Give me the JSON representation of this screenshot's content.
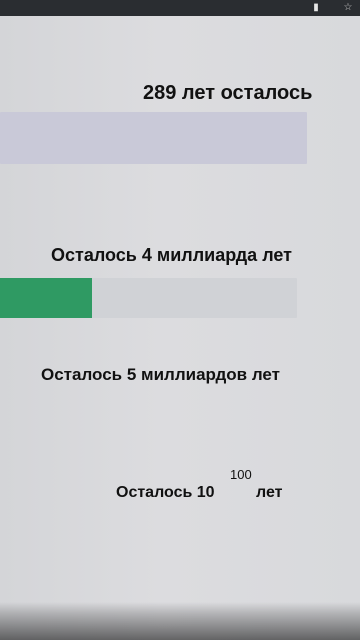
{
  "status_bar": {
    "icons": [
      "phone-icon",
      "star-icon"
    ]
  },
  "items": [
    {
      "label": "289 лет осталось",
      "progress": 0
    },
    {
      "label": "Осталось 4 миллиарда лет",
      "progress": 0.31
    },
    {
      "label": "Осталось 5 миллиардов лет"
    },
    {
      "label_prefix": "Осталось 10",
      "label_exponent": "100",
      "label_suffix": "лет"
    }
  ],
  "colors": {
    "bar_fill": "#2f9a63",
    "track1": "#c9c9d8",
    "track2": "#d0d2d6",
    "text": "#111111"
  }
}
